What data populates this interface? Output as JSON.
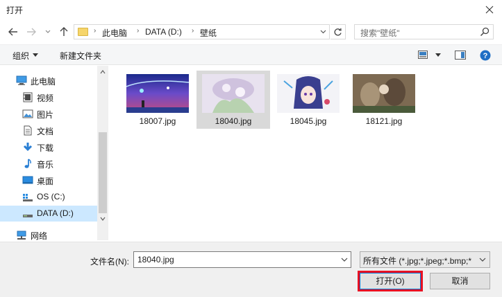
{
  "window": {
    "title": "打开"
  },
  "nav": {
    "breadcrumb": [
      "此电脑",
      "DATA (D:)",
      "壁纸"
    ],
    "search_placeholder": "搜索\"壁纸\""
  },
  "toolbar": {
    "organize": "组织",
    "new_folder": "新建文件夹"
  },
  "sidebar": {
    "items": [
      {
        "label": "此电脑",
        "icon": "computer-icon",
        "top": true
      },
      {
        "label": "视频",
        "icon": "video-icon"
      },
      {
        "label": "图片",
        "icon": "pictures-icon"
      },
      {
        "label": "文档",
        "icon": "documents-icon"
      },
      {
        "label": "下载",
        "icon": "download-icon"
      },
      {
        "label": "音乐",
        "icon": "music-icon"
      },
      {
        "label": "桌面",
        "icon": "desktop-icon"
      },
      {
        "label": "OS (C:)",
        "icon": "drive-c-icon"
      },
      {
        "label": "DATA (D:)",
        "icon": "drive-d-icon",
        "selected": true
      },
      {
        "label": "网络",
        "icon": "network-icon",
        "top": true
      }
    ]
  },
  "files": [
    {
      "name": "18007.jpg",
      "selected": false
    },
    {
      "name": "18040.jpg",
      "selected": true
    },
    {
      "name": "18045.jpg",
      "selected": false
    },
    {
      "name": "18121.jpg",
      "selected": false
    }
  ],
  "bottom": {
    "filename_label": "文件名(N):",
    "filename_value": "18040.jpg",
    "filetype_value": "所有文件 (*.jpg;*.jpeg;*.bmp;*",
    "open_label": "打开(O)",
    "cancel_label": "取消"
  },
  "colors": {
    "selection": "#cce8ff",
    "accent": "#0078d7",
    "highlight_border": "#e81123"
  }
}
